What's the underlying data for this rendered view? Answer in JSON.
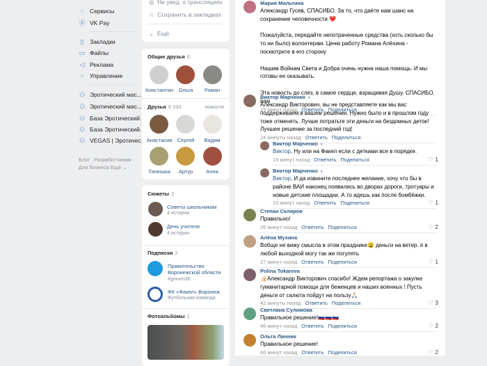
{
  "nav": {
    "items": [
      {
        "label": "Сервисы",
        "icon": "services-icon"
      },
      {
        "label": "VK Pay",
        "icon": "vkpay-icon"
      },
      {
        "label": "Закладки",
        "icon": "bookmark-icon"
      },
      {
        "label": "Файлы",
        "icon": "file-icon"
      },
      {
        "label": "Реклама",
        "icon": "megaphone-icon"
      },
      {
        "label": "Управление",
        "icon": "manage-icon"
      }
    ],
    "groups": [
      "Эротический мас...",
      "Эротический мас...",
      "База Эротический...",
      "База Эротический...",
      "VEGAS | Эротичес..."
    ],
    "footer": {
      "blog": "Блог",
      "dev": "Разработчикам",
      "business": "Для бизнеса",
      "more": "Ещё"
    }
  },
  "profile_menu": {
    "notify": "Не увед. о трансляциях",
    "save": "Сохранить в закладках",
    "more": "Ещё"
  },
  "mutual": {
    "title": "Общие друзья",
    "count": "6",
    "names": [
      "Константин",
      "Ольга",
      "Роман"
    ]
  },
  "friends": {
    "title": "Друзья",
    "count": "9 193",
    "news": "новости",
    "names": [
      "Анастасия",
      "Сергей",
      "Вадим",
      "Танюшка",
      "Артур",
      "Анна"
    ]
  },
  "stories": {
    "title": "Сюжеты",
    "count": "2",
    "items": [
      {
        "title": "Советы школьникам",
        "sub": "4 истории"
      },
      {
        "title": "День учителя",
        "sub": "4 истории"
      }
    ]
  },
  "subs": {
    "title": "Подписки",
    "count": "2",
    "items": [
      {
        "title1": "Правительство",
        "title2": "Воронежской области",
        "sub": "#govvrn36"
      },
      {
        "title1": "ФК «Факел» Воронеж",
        "sub": "Футбольная команда"
      }
    ]
  },
  "albums": {
    "title": "Фотоальбомы",
    "count": "1"
  },
  "actions": {
    "reply": "Ответить",
    "share": "Поделиться"
  },
  "comments": [
    {
      "name": "Мария Мальтина",
      "text": "Александр Гусев, СПАСИБО. За то, что даёте нам шанс на сохранение человечности ❤️\n\nПожалуйста, передайте непотраченные средства (хоть сколько бы то ни было) волонтерам. Ценю работу Романа Алёхина - посмотрите в его сторону\n\nНашим Войнам Света и Добра очень нужна наша помощь. И мы готовы ее оказывать.\n\nЭта новость до слез, в самое сердце, взращивая Душу. СПАСИБО, вам",
      "time": "19 минут назад",
      "likes": ""
    },
    {
      "name": "Виктор Марченко",
      "text": "Александр Викторович, вы не представляете как мы вас поддерживаем в вашем решении. Нужно было и в прошлом году тоже отменять. Лучше потратьте эти деньги на бездомных деток! Лучшее решение за последний год!",
      "time": "24 минуты назад",
      "likes": ""
    },
    {
      "name": "Виктор Марченко",
      "mention": "Виктор",
      "text": ", Ну или на Факел если с детками все в порядке.",
      "time": "19 минут назад",
      "likes": "1"
    },
    {
      "name": "Виктор Марченко",
      "mention": "Виктор",
      "text": ", И да извините последнее желание, хочу что бы в районе ВАИ наконец появились во дворах дороги, тротуары и новые детские площадки. А то идешь как после бомбёжки.",
      "time": "15 минут назад",
      "likes": "1"
    },
    {
      "name": "Степан Скляров",
      "text": "Правильно!",
      "time": "26 минут назад",
      "likes": "2"
    },
    {
      "name": "Алёна Мухина",
      "text": "Вобще не вижу смысла в этом празднике😩 деньги на ветер. я в любой выходной могу так же погулять",
      "time": "27 минут назад",
      "likes": "1"
    },
    {
      "name": "Polina Tokareva",
      "text": "👍🏻Александр Викторович спасибо! Ждем репортажа о закупке гуманитарной помощи для беженцев и наших военных ! Пусть деньги от салюта пойдут на пользу🙏🏻",
      "time": "42 минуты назад",
      "likes": "3"
    },
    {
      "name": "Светлана Сулимова",
      "text": "Правильное решение!🇷🇺🇷🇺🇷🇺",
      "time": "46 минут назад",
      "likes": "2"
    },
    {
      "name": "Ольга Линник",
      "text": "Правильное решение!",
      "time": "46 минут назад",
      "likes": "2"
    }
  ]
}
